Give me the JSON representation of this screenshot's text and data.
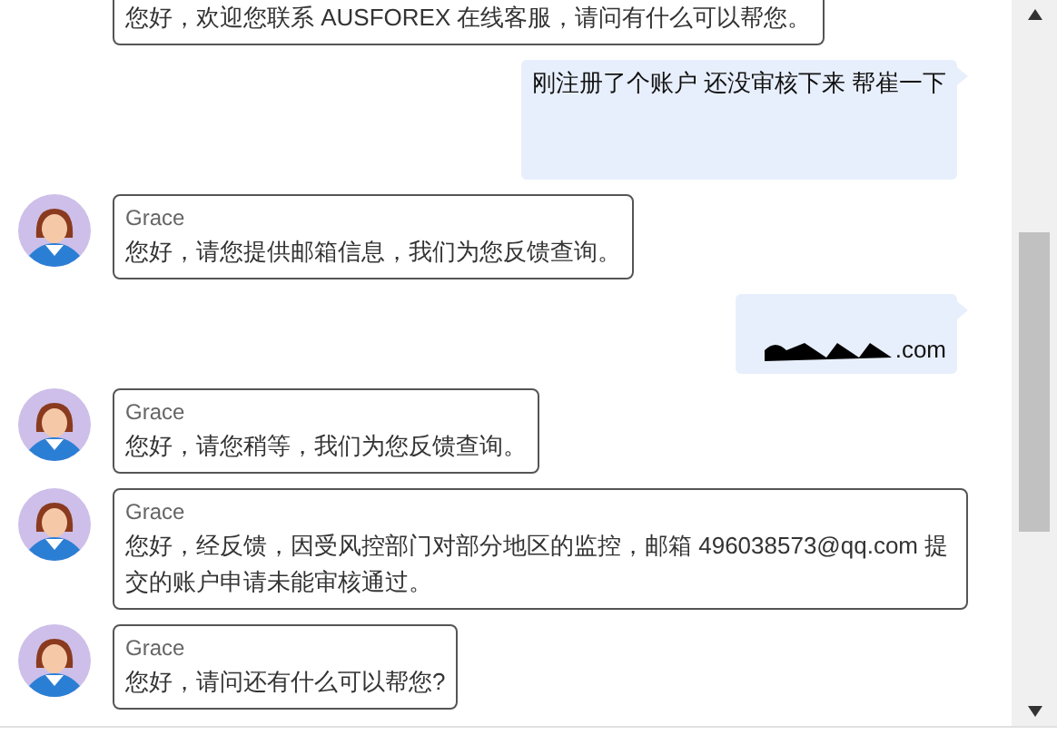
{
  "messages": [
    {
      "kind": "agent",
      "text": "您好，欢迎您联系 AUSFOREX 在线客服，请问有什么可以帮您。"
    },
    {
      "kind": "user",
      "text": "刚注册了个账户 还没审核下来 帮崔一下",
      "redacted": false
    },
    {
      "kind": "agent",
      "sender": "Grace",
      "text": "您好，请您提供邮箱信息，我们为您反馈查询。"
    },
    {
      "kind": "user",
      "text": ".com",
      "redacted": true
    },
    {
      "kind": "agent",
      "sender": "Grace",
      "text": "您好，请您稍等，我们为您反馈查询。"
    },
    {
      "kind": "agent",
      "sender": "Grace",
      "text": "您好，经反馈，因受风控部门对部分地区的监控，邮箱 496038573@qq.com 提交的账户申请未能审核通过。"
    },
    {
      "kind": "agent",
      "sender": "Grace",
      "text": "您好，请问还有什么可以帮您?"
    }
  ]
}
